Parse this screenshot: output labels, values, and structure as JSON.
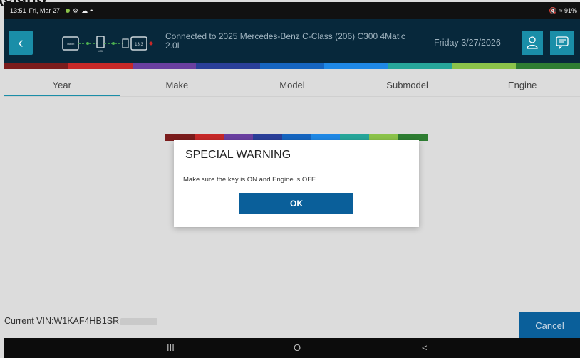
{
  "cropped_header_text": "(eight)",
  "status_bar": {
    "time": "13:51",
    "date": "Fri, Mar 27",
    "right_info": "91%"
  },
  "header": {
    "connection_text": "Connected to 2025 Mercedes-Benz C-Class (206) C300 4Matic 2.0L",
    "date": "Friday 3/27/2026",
    "diagram_labels": {
      "tablet": "Tablet",
      "vci": "VCI",
      "battery": "13.3"
    }
  },
  "tabs": [
    {
      "label": "Year",
      "active": true
    },
    {
      "label": "Make",
      "active": false
    },
    {
      "label": "Model",
      "active": false
    },
    {
      "label": "Submodel",
      "active": false
    },
    {
      "label": "Engine",
      "active": false
    }
  ],
  "vin": {
    "label": "Current VIN:",
    "value": "W1KAF4HB1SR"
  },
  "cancel_label": "Cancel",
  "dialog": {
    "title": "SPECIAL WARNING",
    "message": "Make sure the key is ON and Engine is OFF",
    "ok_label": "OK"
  },
  "nav": {
    "recents": "III",
    "home": "O",
    "back": "<"
  },
  "colors": {
    "brand_dark": "#07283b",
    "accent_teal": "#1a8ea8",
    "button_blue": "#0a5f9a",
    "stripe": [
      "#7b1c1c",
      "#c62828",
      "#6a3fa0",
      "#2a3f99",
      "#1565c0",
      "#1e88e5",
      "#26a69a",
      "#8bc34a",
      "#2e7d32"
    ]
  }
}
